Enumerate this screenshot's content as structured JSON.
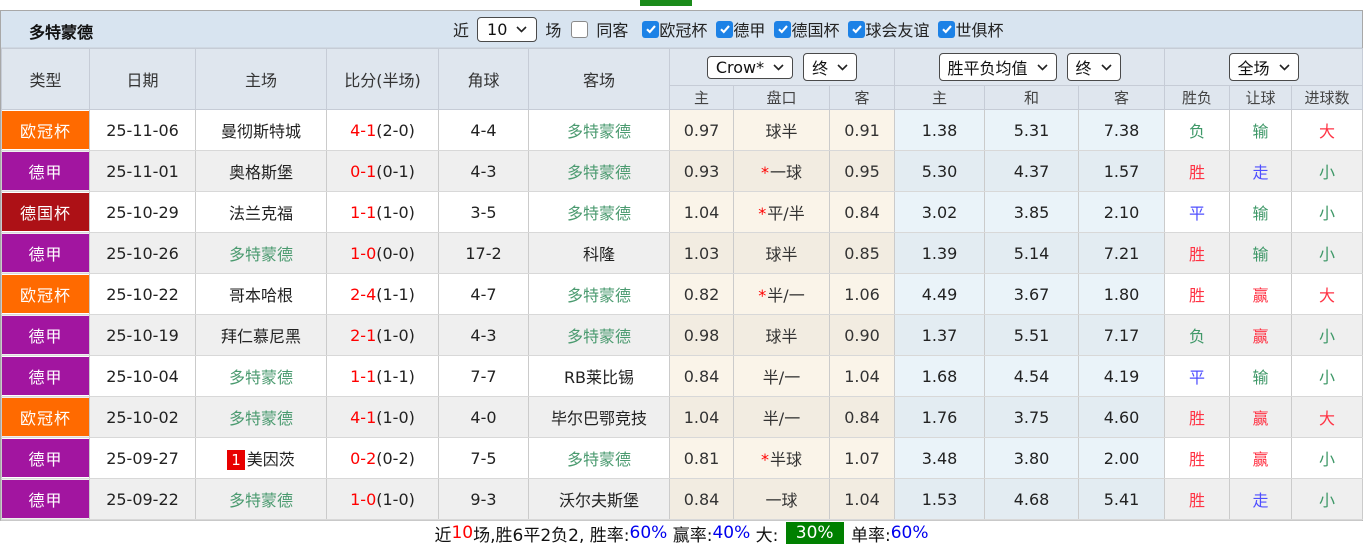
{
  "header": {
    "title": "多特蒙德",
    "recent_label": "近",
    "recent_value": "10",
    "games_label": "场",
    "same_away": {
      "label": "同客",
      "checked": false
    },
    "filters": [
      {
        "label": "欧冠杯",
        "checked": true
      },
      {
        "label": "德甲",
        "checked": true
      },
      {
        "label": "德国杯",
        "checked": true
      },
      {
        "label": "球会友谊",
        "checked": true
      },
      {
        "label": "世俱杯",
        "checked": true
      }
    ]
  },
  "table": {
    "columns": [
      "类型",
      "日期",
      "主场",
      "比分(半场)",
      "角球",
      "客场"
    ],
    "controls": {
      "bookmaker": "Crow*",
      "bookmaker_time": "终",
      "europe_avg": "胜平负均值",
      "europe_time": "终",
      "scope": "全场"
    },
    "sub_headers": [
      "主",
      "盘口",
      "客",
      "主",
      "和",
      "客",
      "胜负",
      "让球",
      "进球数"
    ],
    "league_colors": {
      "欧冠杯": "#ff6a00",
      "德甲": "#a215a0",
      "德国杯": "#ad1116"
    },
    "self_team": "多特蒙德",
    "rows": [
      {
        "league": "欧冠杯",
        "date": "25-11-06",
        "home": "曼彻斯特城",
        "home_self": false,
        "home_card": "",
        "score": "4-1",
        "half": "(2-0)",
        "corners": "4-4",
        "away": "多特蒙德",
        "away_self": true,
        "asia_home": "0.97",
        "star_mark": "",
        "handicap": "球半",
        "asia_away": "0.91",
        "euro_home": "1.38",
        "euro_draw": "5.31",
        "euro_away": "7.38",
        "res_wdl": {
          "text": "负",
          "color": "green"
        },
        "res_let": {
          "text": "输",
          "color": "green"
        },
        "res_goal": {
          "text": "大",
          "color": "red"
        }
      },
      {
        "league": "德甲",
        "date": "25-11-01",
        "home": "奥格斯堡",
        "home_self": false,
        "home_card": "",
        "score": "0-1",
        "half": "(0-1)",
        "corners": "4-3",
        "away": "多特蒙德",
        "away_self": true,
        "asia_home": "0.93",
        "star_mark": "*",
        "handicap": "一球",
        "asia_away": "0.95",
        "euro_home": "5.30",
        "euro_draw": "4.37",
        "euro_away": "1.57",
        "res_wdl": {
          "text": "胜",
          "color": "red"
        },
        "res_let": {
          "text": "走",
          "color": "blue"
        },
        "res_goal": {
          "text": "小",
          "color": "green"
        }
      },
      {
        "league": "德国杯",
        "date": "25-10-29",
        "home": "法兰克福",
        "home_self": false,
        "home_card": "",
        "score": "1-1",
        "half": "(1-0)",
        "corners": "3-5",
        "away": "多特蒙德",
        "away_self": true,
        "asia_home": "1.04",
        "star_mark": "*",
        "handicap": "平/半",
        "asia_away": "0.84",
        "euro_home": "3.02",
        "euro_draw": "3.85",
        "euro_away": "2.10",
        "res_wdl": {
          "text": "平",
          "color": "blue"
        },
        "res_let": {
          "text": "输",
          "color": "green"
        },
        "res_goal": {
          "text": "小",
          "color": "green"
        }
      },
      {
        "league": "德甲",
        "date": "25-10-26",
        "home": "多特蒙德",
        "home_self": true,
        "home_card": "",
        "score": "1-0",
        "half": "(0-0)",
        "corners": "17-2",
        "away": "科隆",
        "away_self": false,
        "asia_home": "1.03",
        "star_mark": "",
        "handicap": "球半",
        "asia_away": "0.85",
        "euro_home": "1.39",
        "euro_draw": "5.14",
        "euro_away": "7.21",
        "res_wdl": {
          "text": "胜",
          "color": "red"
        },
        "res_let": {
          "text": "输",
          "color": "green"
        },
        "res_goal": {
          "text": "小",
          "color": "green"
        }
      },
      {
        "league": "欧冠杯",
        "date": "25-10-22",
        "home": "哥本哈根",
        "home_self": false,
        "home_card": "",
        "score": "2-4",
        "half": "(1-1)",
        "corners": "4-7",
        "away": "多特蒙德",
        "away_self": true,
        "asia_home": "0.82",
        "star_mark": "*",
        "handicap": "半/一",
        "asia_away": "1.06",
        "euro_home": "4.49",
        "euro_draw": "3.67",
        "euro_away": "1.80",
        "res_wdl": {
          "text": "胜",
          "color": "red"
        },
        "res_let": {
          "text": "赢",
          "color": "red"
        },
        "res_goal": {
          "text": "大",
          "color": "red"
        }
      },
      {
        "league": "德甲",
        "date": "25-10-19",
        "home": "拜仁慕尼黑",
        "home_self": false,
        "home_card": "",
        "score": "2-1",
        "half": "(1-0)",
        "corners": "4-3",
        "away": "多特蒙德",
        "away_self": true,
        "asia_home": "0.98",
        "star_mark": "",
        "handicap": "球半",
        "asia_away": "0.90",
        "euro_home": "1.37",
        "euro_draw": "5.51",
        "euro_away": "7.17",
        "res_wdl": {
          "text": "负",
          "color": "green"
        },
        "res_let": {
          "text": "赢",
          "color": "red"
        },
        "res_goal": {
          "text": "小",
          "color": "green"
        }
      },
      {
        "league": "德甲",
        "date": "25-10-04",
        "home": "多特蒙德",
        "home_self": true,
        "home_card": "",
        "score": "1-1",
        "half": "(1-1)",
        "corners": "7-7",
        "away": "RB莱比锡",
        "away_self": false,
        "asia_home": "0.84",
        "star_mark": "",
        "handicap": "半/一",
        "asia_away": "1.04",
        "euro_home": "1.68",
        "euro_draw": "4.54",
        "euro_away": "4.19",
        "res_wdl": {
          "text": "平",
          "color": "blue"
        },
        "res_let": {
          "text": "输",
          "color": "green"
        },
        "res_goal": {
          "text": "小",
          "color": "green"
        }
      },
      {
        "league": "欧冠杯",
        "date": "25-10-02",
        "home": "多特蒙德",
        "home_self": true,
        "home_card": "",
        "score": "4-1",
        "half": "(1-0)",
        "corners": "4-0",
        "away": "毕尔巴鄂竞技",
        "away_self": false,
        "asia_home": "1.04",
        "star_mark": "",
        "handicap": "半/一",
        "asia_away": "0.84",
        "euro_home": "1.76",
        "euro_draw": "3.75",
        "euro_away": "4.60",
        "res_wdl": {
          "text": "胜",
          "color": "red"
        },
        "res_let": {
          "text": "赢",
          "color": "red"
        },
        "res_goal": {
          "text": "大",
          "color": "red"
        }
      },
      {
        "league": "德甲",
        "date": "25-09-27",
        "home": "美因茨",
        "home_self": false,
        "home_card": "1",
        "score": "0-2",
        "half": "(0-2)",
        "corners": "7-5",
        "away": "多特蒙德",
        "away_self": true,
        "asia_home": "0.81",
        "star_mark": "*",
        "handicap": "半球",
        "asia_away": "1.07",
        "euro_home": "3.48",
        "euro_draw": "3.80",
        "euro_away": "2.00",
        "res_wdl": {
          "text": "胜",
          "color": "red"
        },
        "res_let": {
          "text": "赢",
          "color": "red"
        },
        "res_goal": {
          "text": "小",
          "color": "green"
        }
      },
      {
        "league": "德甲",
        "date": "25-09-22",
        "home": "多特蒙德",
        "home_self": true,
        "home_card": "",
        "score": "1-0",
        "half": "(1-0)",
        "corners": "9-3",
        "away": "沃尔夫斯堡",
        "away_self": false,
        "asia_home": "0.84",
        "star_mark": "",
        "handicap": "一球",
        "asia_away": "1.04",
        "euro_home": "1.53",
        "euro_draw": "4.68",
        "euro_away": "5.41",
        "res_wdl": {
          "text": "胜",
          "color": "red"
        },
        "res_let": {
          "text": "走",
          "color": "blue"
        },
        "res_goal": {
          "text": "小",
          "color": "green"
        }
      }
    ]
  },
  "footer": {
    "segments": [
      {
        "text": "近",
        "style": "plain"
      },
      {
        "text": "10",
        "style": "red"
      },
      {
        "text": "场,胜6平2负2, 胜率:",
        "style": "plain"
      },
      {
        "text": "60%",
        "style": "blue"
      },
      {
        "text": " 赢率:",
        "style": "plain"
      },
      {
        "text": "40%",
        "style": "blue"
      },
      {
        "text": " 大: ",
        "style": "plain"
      },
      {
        "text": "30%",
        "style": "green-box"
      },
      {
        "text": " 单率:",
        "style": "plain"
      },
      {
        "text": "60%",
        "style": "blue"
      }
    ],
    "highlight_color": "#008000"
  }
}
